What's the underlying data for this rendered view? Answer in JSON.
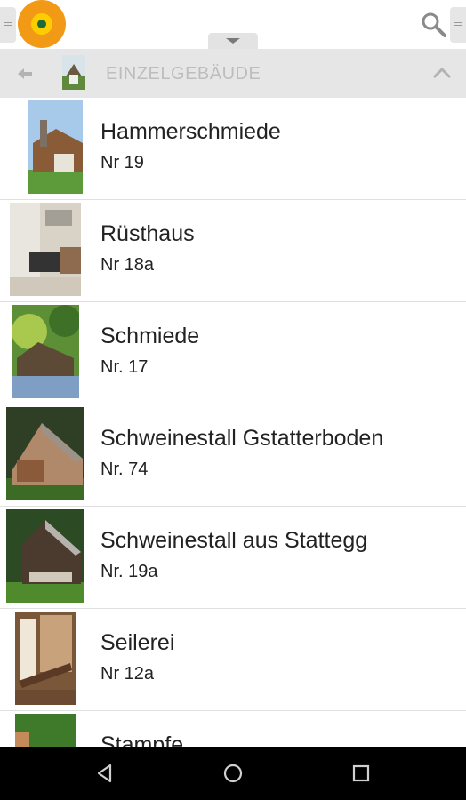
{
  "topbar": {
    "logo_icon": "museum-logo",
    "search_icon": "search-icon",
    "pulldown_icon": "chevron-down-icon"
  },
  "section": {
    "title": "EINZELGEBÄUDE",
    "back_icon": "back-arrow-icon",
    "collapse_icon": "chevron-up-icon"
  },
  "items": [
    {
      "title": "Hammerschmiede",
      "subtitle": "Nr 19"
    },
    {
      "title": "Rüsthaus",
      "subtitle": "Nr 18a"
    },
    {
      "title": "Schmiede",
      "subtitle": "Nr. 17"
    },
    {
      "title": "Schweinestall Gstatterboden",
      "subtitle": "Nr. 74"
    },
    {
      "title": "Schweinestall aus Stattegg",
      "subtitle": "Nr. 19a"
    },
    {
      "title": "Seilerei",
      "subtitle": "Nr 12a"
    },
    {
      "title": "Stampfe",
      "subtitle": ""
    }
  ],
  "navbar": {
    "back_icon": "nav-back-icon",
    "home_icon": "nav-home-icon",
    "recents_icon": "nav-recents-icon"
  },
  "colors": {
    "logo_orange": "#f29a16",
    "logo_yellow": "#ffcc00",
    "header_bg": "#e6e6e6",
    "header_text": "#bdbdbd"
  }
}
